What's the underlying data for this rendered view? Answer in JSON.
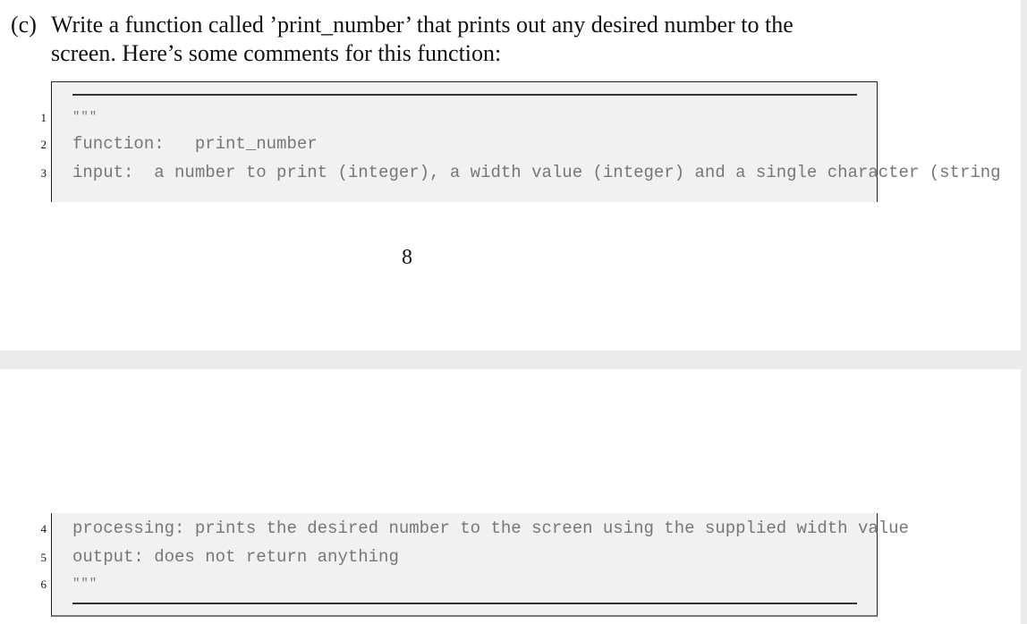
{
  "question": {
    "label": "(c)",
    "line1": "Write a function called ’print_number’ that prints out any desired number to the",
    "line2": "screen. Here’s some comments for this function:"
  },
  "code": {
    "lines": [
      {
        "number": "1",
        "text": "\"\"\""
      },
      {
        "number": "2",
        "text": "function:   print_number"
      },
      {
        "number": "3",
        "text": "input:  a number to print (integer), a width value (integer) and a single character (string"
      },
      {
        "number": "4",
        "text": "processing: prints the desired number to the screen using the supplied width value"
      },
      {
        "number": "5",
        "text": "output: does not return anything"
      },
      {
        "number": "6",
        "text": "\"\"\""
      }
    ]
  },
  "page_number": "8"
}
